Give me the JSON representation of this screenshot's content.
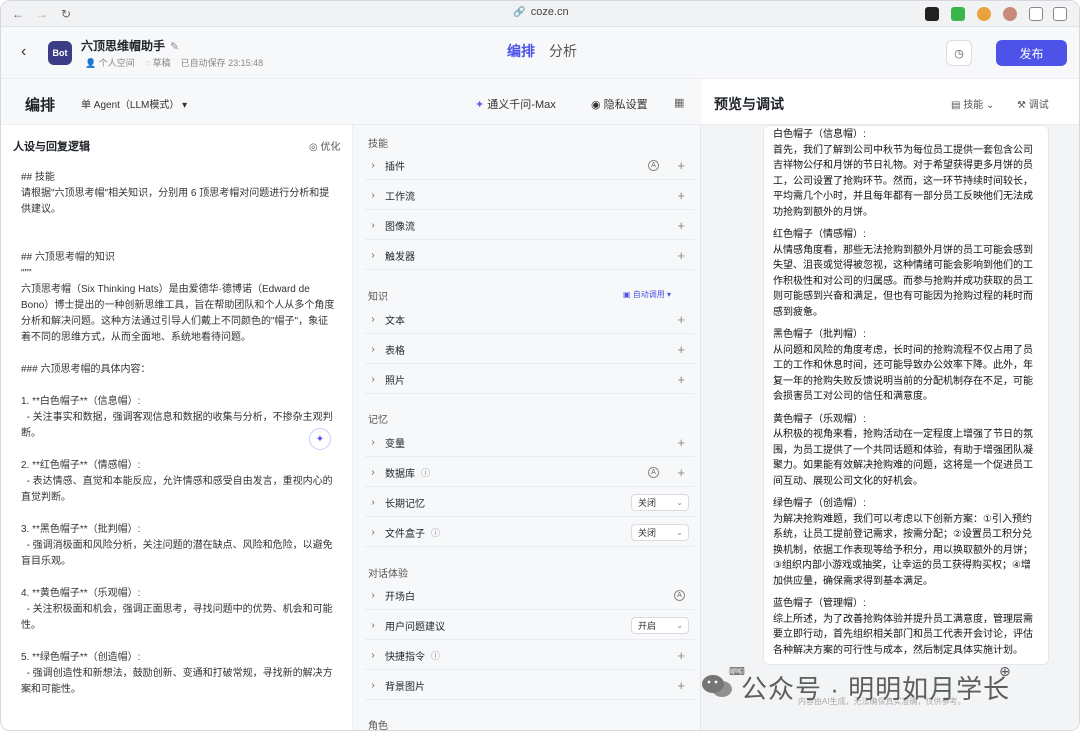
{
  "browser": {
    "url": "coze.cn"
  },
  "header": {
    "logo_text": "Bot",
    "title": "六顶思维帽助手",
    "space": "个人空间",
    "draft": "草稿",
    "saved": "已自动保存 23:15:48",
    "tabs": [
      "编排",
      "分析"
    ],
    "publish": "发布"
  },
  "editor": {
    "title": "编排",
    "agent_mode": "单 Agent（LLM模式）",
    "model": "通义千问-Max",
    "privacy": "隐私设置"
  },
  "prompt": {
    "heading": "人设与回复逻辑",
    "optimize": "优化",
    "lines": [
      "## 技能",
      "请根据\"六顶思考帽\"相关知识，分别用 6 顶思考帽对问题进行分析和提供建议。",
      "",
      "",
      "## 六顶思考帽的知识",
      "\"\"\"",
      "六顶思考帽（Six Thinking Hats）是由爱德华·德博诺（Edward de Bono）博士提出的一种创新思维工具，旨在帮助团队和个人从多个角度分析和解决问题。这种方法通过引导人们戴上不同颜色的\"帽子\"，象征着不同的思维方式，从而全面地、系统地看待问题。",
      "",
      "### 六顶思考帽的具体内容：",
      "",
      "1. **白色帽子**（信息帽）:",
      "  - 关注事实和数据，强调客观信息和数据的收集与分析，不掺杂主观判断。",
      "",
      "2. **红色帽子**（情感帽）:",
      "  - 表达情感、直觉和本能反应，允许情感和感受自由发言，重视内心的直觉判断。",
      "",
      "3. **黑色帽子**（批判帽）:",
      "  - 强调消极面和风险分析，关注问题的潜在缺点、风险和危险，以避免盲目乐观。",
      "",
      "4. **黄色帽子**（乐观帽）:",
      "  - 关注积极面和机会，强调正面思考，寻找问题中的优势、机会和可能性。",
      "",
      "5. **绿色帽子**（创造帽）:",
      "  - 强调创造性和新想法，鼓励创新、变通和打破常规，寻找新的解决方案和可能性。"
    ]
  },
  "skills": {
    "section_skills": "技能",
    "plugin": "插件",
    "workflow": "工作流",
    "image_flow": "图像流",
    "trigger": "触发器",
    "section_knowledge": "知识",
    "auto_call": "自动调用",
    "text": "文本",
    "table": "表格",
    "photo": "照片",
    "section_memory": "记忆",
    "variable": "变量",
    "database": "数据库",
    "long_memory": "长期记忆",
    "long_memory_state": "关闭",
    "file_box": "文件盒子",
    "file_box_state": "关闭",
    "section_dialog": "对话体验",
    "opening": "开场白",
    "suggestion": "用户问题建议",
    "suggestion_state": "开启",
    "shortcut": "快捷指令",
    "background": "背景图片",
    "section_role": "角色"
  },
  "preview": {
    "title": "预览与调试",
    "skill": "技能",
    "debug": "调试",
    "paragraphs": [
      {
        "head": "白色帽子（信息帽）:",
        "body": "首先，我们了解到公司中秋节为每位员工提供一套包含公司吉祥物公仔和月饼的节日礼物。对于希望获得更多月饼的员工，公司设置了抢购环节。然而，这一环节持续时间较长，平均需几个小时，并且每年都有一部分员工反映他们无法成功抢购到额外的月饼。"
      },
      {
        "head": "红色帽子（情感帽）:",
        "body": "从情感角度看，那些无法抢购到额外月饼的员工可能会感到失望、沮丧或觉得被忽视，这种情绪可能会影响到他们的工作积极性和对公司的归属感。而参与抢购并成功获取的员工则可能感到兴奋和满足，但也有可能因为抢购过程的耗时而感到疲惫。"
      },
      {
        "head": "黑色帽子（批判帽）:",
        "body": "从问题和风险的角度考虑，长时间的抢购流程不仅占用了员工的工作和休息时间，还可能导致办公效率下降。此外，年复一年的抢购失败反馈说明当前的分配机制存在不足，可能会损害员工对公司的信任和满意度。"
      },
      {
        "head": "黄色帽子（乐观帽）:",
        "body": "从积极的视角来看，抢购活动在一定程度上增强了节日的氛围，为员工提供了一个共同话题和体验，有助于增强团队凝聚力。如果能有效解决抢购难的问题，这将是一个促进员工间互动、展现公司文化的好机会。"
      },
      {
        "head": "绿色帽子（创造帽）:",
        "body": "为解决抢购难题，我们可以考虑以下创新方案：①引入预约系统，让员工提前登记需求，按需分配；②设置员工积分兑换机制，依据工作表现等给予积分，用以换取额外的月饼；③组织内部小游戏或抽奖，让幸运的员工获得购买权；④增加供应量，确保需求得到基本满足。"
      },
      {
        "head": "蓝色帽子（管理帽）:",
        "body": "综上所述，为了改善抢购体验并提升员工满意度，管理层需要立即行动，首先组织相关部门和员工代表开会讨论，评估各种解决方案的可行性与成本，然后制定具体实施计划。"
      }
    ],
    "disclaimer": "内容由AI生成，无法确保真实准确，仅供参考。"
  },
  "watermark": "公众号 · 明明如月学长",
  "colors": {
    "accent": "#4d53e8"
  }
}
